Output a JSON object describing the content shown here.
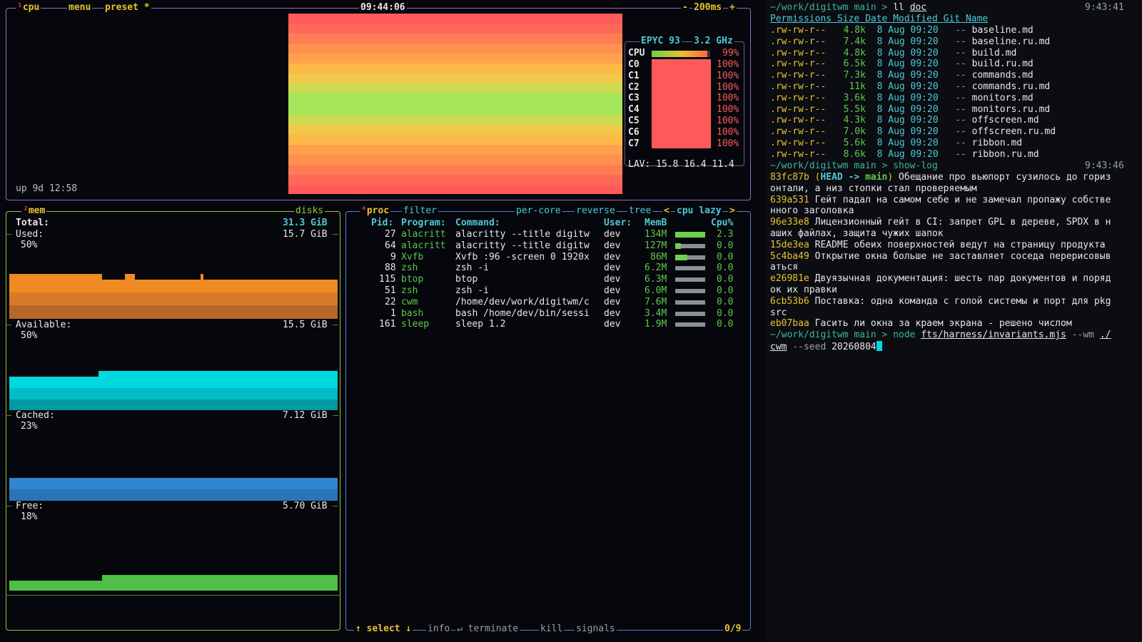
{
  "cpu_box": {
    "title_num": "¹",
    "title": "cpu",
    "menu": "menu",
    "preset": "preset *",
    "clock": "09:44:06",
    "interval_minus": "-",
    "interval": "200ms",
    "interval_plus": "+",
    "uptime": "up 9d 12:58",
    "model": "EPYC 93",
    "freq": "3.2 GHz",
    "total_label": "CPU",
    "total_pct": "99%",
    "cores": [
      {
        "name": "C0",
        "pct": "100%"
      },
      {
        "name": "C1",
        "pct": "100%"
      },
      {
        "name": "C2",
        "pct": "100%"
      },
      {
        "name": "C3",
        "pct": "100%"
      },
      {
        "name": "C4",
        "pct": "100%"
      },
      {
        "name": "C5",
        "pct": "100%"
      },
      {
        "name": "C6",
        "pct": "100%"
      },
      {
        "name": "C7",
        "pct": "100%"
      }
    ],
    "lav_label": "LAV:",
    "lav": [
      "15.8",
      "16.4",
      "11.4"
    ]
  },
  "mem_box": {
    "title_num": "²",
    "title": "mem",
    "disks": "disks",
    "total_label": "Total:",
    "total": "31.3 GiB",
    "rows": [
      {
        "label": "Used:",
        "value": "15.7 GiB",
        "pct": "50%",
        "level": 0.5,
        "color": "#f08a24"
      },
      {
        "label": "Available:",
        "value": "15.5 GiB",
        "pct": "50%",
        "level": 0.5,
        "color": "#00c8d0"
      },
      {
        "label": "Cached:",
        "value": "7.12 GiB",
        "pct": "23%",
        "level": 0.23,
        "color": "#2f86d4"
      },
      {
        "label": "Free:",
        "value": "5.70 GiB",
        "pct": "18%",
        "level": 0.18,
        "color": "#4fbf45"
      }
    ]
  },
  "proc_box": {
    "title_num": "⁴",
    "title": "proc",
    "filter": "filter",
    "per_core": "per-core",
    "reverse": "reverse",
    "tree": "tree",
    "sort_prev": "<",
    "sort": "cpu lazy",
    "sort_next": ">",
    "headers": {
      "pid": "Pid:",
      "program": "Program:",
      "command": "Command:",
      "user": "User:",
      "mem": "MemB",
      "cpu": "Cpu%"
    },
    "rows": [
      {
        "pid": "27",
        "program": "alacritt",
        "command": "alacritty --title digitw",
        "user": "dev",
        "mem": "134M",
        "cpu": "2.3",
        "load": 1.0
      },
      {
        "pid": "64",
        "program": "alacritt",
        "command": "alacritty --title digitw",
        "user": "dev",
        "mem": "127M",
        "cpu": "0.0",
        "load": 0.2
      },
      {
        "pid": "9",
        "program": "Xvfb",
        "command": "Xvfb :96 -screen 0 1920x",
        "user": "dev",
        "mem": "86M",
        "cpu": "0.0",
        "load": 0.4
      },
      {
        "pid": "88",
        "program": "zsh",
        "command": "zsh -i",
        "user": "dev",
        "mem": "6.2M",
        "cpu": "0.0",
        "load": 0.0
      },
      {
        "pid": "115",
        "program": "btop",
        "command": "btop",
        "user": "dev",
        "mem": "6.3M",
        "cpu": "0.0",
        "load": 0.0
      },
      {
        "pid": "51",
        "program": "zsh",
        "command": "zsh -i",
        "user": "dev",
        "mem": "6.0M",
        "cpu": "0.0",
        "load": 0.0
      },
      {
        "pid": "22",
        "program": "cwm",
        "command": "/home/dev/work/digitwm/c",
        "user": "dev",
        "mem": "7.6M",
        "cpu": "0.0",
        "load": 0.0
      },
      {
        "pid": "1",
        "program": "bash",
        "command": "bash /home/dev/bin/sessi",
        "user": "dev",
        "mem": "3.4M",
        "cpu": "0.0",
        "load": 0.0
      },
      {
        "pid": "161",
        "program": "sleep",
        "command": "sleep 1.2",
        "user": "dev",
        "mem": "1.9M",
        "cpu": "0.0",
        "load": 0.0
      }
    ],
    "footer": {
      "select_arrow": "↑",
      "select": "select",
      "info_arrow": "↓",
      "info": "info",
      "terminate_key": "↵",
      "terminate": "terminate",
      "kill": "kill",
      "signals": "signals",
      "count": "0/9"
    }
  },
  "terminal": {
    "ll_prompt": {
      "path": "~/work/digitwm",
      "branch": "main",
      "arrow": ">",
      "cmd": "ll",
      "arg": "doc",
      "time": "9:43:41"
    },
    "ll_headers": [
      "Permissions",
      "Size",
      "Date Modified",
      "Git",
      "Name"
    ],
    "files": [
      {
        "perm": ".rw-rw-r--",
        "size": "4.8k",
        "date": "8 Aug 09:20",
        "git": "--",
        "name": "baseline.md"
      },
      {
        "perm": ".rw-rw-r--",
        "size": "7.4k",
        "date": "8 Aug 09:20",
        "git": "--",
        "name": "baseline.ru.md"
      },
      {
        "perm": ".rw-rw-r--",
        "size": "4.8k",
        "date": "8 Aug 09:20",
        "git": "--",
        "name": "build.md"
      },
      {
        "perm": ".rw-rw-r--",
        "size": "6.5k",
        "date": "8 Aug 09:20",
        "git": "--",
        "name": "build.ru.md"
      },
      {
        "perm": ".rw-rw-r--",
        "size": "7.3k",
        "date": "8 Aug 09:20",
        "git": "--",
        "name": "commands.md"
      },
      {
        "perm": ".rw-rw-r--",
        "size": "11k",
        "date": "8 Aug 09:20",
        "git": "--",
        "name": "commands.ru.md"
      },
      {
        "perm": ".rw-rw-r--",
        "size": "3.6k",
        "date": "8 Aug 09:20",
        "git": "--",
        "name": "monitors.md"
      },
      {
        "perm": ".rw-rw-r--",
        "size": "5.5k",
        "date": "8 Aug 09:20",
        "git": "--",
        "name": "monitors.ru.md"
      },
      {
        "perm": ".rw-rw-r--",
        "size": "4.3k",
        "date": "8 Aug 09:20",
        "git": "--",
        "name": "offscreen.md"
      },
      {
        "perm": ".rw-rw-r--",
        "size": "7.0k",
        "date": "8 Aug 09:20",
        "git": "--",
        "name": "offscreen.ru.md"
      },
      {
        "perm": ".rw-rw-r--",
        "size": "5.6k",
        "date": "8 Aug 09:20",
        "git": "--",
        "name": "ribbon.md"
      },
      {
        "perm": ".rw-rw-r--",
        "size": "8.6k",
        "date": "8 Aug 09:20",
        "git": "--",
        "name": "ribbon.ru.md"
      }
    ],
    "log_prompt": {
      "path": "~/work/digitwm",
      "branch": "main",
      "arrow": ">",
      "cmd": "show-log",
      "time": "9:43:46"
    },
    "head_open": "(",
    "head": "HEAD",
    "head_arrow": "->",
    "head_branch": "main",
    "head_close": ")",
    "commits": [
      {
        "hash": "83fc87b",
        "msg": "Обещание про вьюпорт сузилось до гориз",
        "msg2": "онтали, а низ стопки стал проверяемым",
        "head": true
      },
      {
        "hash": "639a531",
        "msg": "Гейт падал на самом себе и не замечал пропажу собстве",
        "msg2": "нного заголовка"
      },
      {
        "hash": "96e33e8",
        "msg": "Лицензионный гейт в CI: запрет GPL в дереве, SPDX в н",
        "msg2": "аших файлах, защита чужих шапок"
      },
      {
        "hash": "15de3ea",
        "msg": "README обеих поверхностей ведут на страницу продукта",
        "msg2": ""
      },
      {
        "hash": "5c4ba49",
        "msg": "Открытие окна больше не заставляет соседа перерисовыв",
        "msg2": "аться"
      },
      {
        "hash": "e26981e",
        "msg": "Двуязычная документация: шесть пар документов и поряд",
        "msg2": "ок их правки"
      },
      {
        "hash": "6cb53b6",
        "msg": "Поставка: одна команда с голой системы и порт для pkg",
        "msg2": "src"
      },
      {
        "hash": "eb07baa",
        "msg": "Гасить ли окна за краем экрана - решено числом",
        "msg2": ""
      }
    ],
    "node_prompt": {
      "path": "~/work/digitwm",
      "branch": "main",
      "arrow": ">",
      "cmd": "node",
      "script": "fts/harness/invariants.mjs",
      "flag": "--wm",
      "wm1": "./",
      "wm2": "cwm",
      "seed_flag": "--seed",
      "seed": "20260804"
    }
  }
}
